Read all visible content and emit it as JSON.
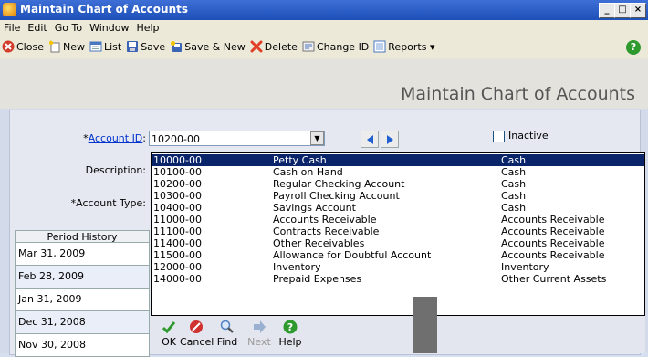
{
  "window": {
    "title": "Maintain Chart of Accounts"
  },
  "menu": [
    "File",
    "Edit",
    "Go To",
    "Window",
    "Help"
  ],
  "toolbar": [
    {
      "label": "Close",
      "icon": "close-icon"
    },
    {
      "label": "New",
      "icon": "new-icon"
    },
    {
      "label": "List",
      "icon": "list-icon"
    },
    {
      "label": "Save",
      "icon": "save-icon"
    },
    {
      "label": "Save & New",
      "icon": "save-new-icon"
    },
    {
      "label": "Delete",
      "icon": "delete-icon"
    },
    {
      "label": "Change ID",
      "icon": "change-id-icon"
    },
    {
      "label": "Reports ▾",
      "icon": "reports-icon"
    }
  ],
  "header": {
    "title": "Maintain Chart of Accounts"
  },
  "form": {
    "account_id_star": "*",
    "account_id_label": "Account ID",
    "account_id_colon": ":",
    "account_id_value": "10200-00",
    "inactive_label": "Inactive",
    "description_label": "Description:",
    "account_type_label": "*Account Type:"
  },
  "period_history": {
    "header": "Period History",
    "rows": [
      "Mar 31, 2009",
      "Feb 28, 2009",
      "Jan 31, 2009",
      "Dec 31, 2008",
      "Nov 30, 2008"
    ]
  },
  "dropdown": {
    "selected_index": 0,
    "rows": [
      {
        "id": "10000-00",
        "name": "Petty Cash",
        "type": "Cash"
      },
      {
        "id": "10100-00",
        "name": "Cash on Hand",
        "type": "Cash"
      },
      {
        "id": "10200-00",
        "name": "Regular Checking Account",
        "type": "Cash"
      },
      {
        "id": "10300-00",
        "name": "Payroll Checking Account",
        "type": "Cash"
      },
      {
        "id": "10400-00",
        "name": "Savings Account",
        "type": "Cash"
      },
      {
        "id": "11000-00",
        "name": "Accounts Receivable",
        "type": "Accounts Receivable"
      },
      {
        "id": "11100-00",
        "name": "Contracts Receivable",
        "type": "Accounts Receivable"
      },
      {
        "id": "11400-00",
        "name": "Other Receivables",
        "type": "Accounts Receivable"
      },
      {
        "id": "11500-00",
        "name": "Allowance for Doubtful Account",
        "type": "Accounts Receivable"
      },
      {
        "id": "12000-00",
        "name": "Inventory",
        "type": "Inventory"
      },
      {
        "id": "14000-00",
        "name": "Prepaid Expenses",
        "type": "Other Current Assets"
      }
    ],
    "tools": [
      {
        "label": "OK",
        "icon": "ok-check-icon",
        "color": "#2e9a2e"
      },
      {
        "label": "Cancel",
        "icon": "cancel-icon",
        "color": "#d03030"
      },
      {
        "label": "Find",
        "icon": "find-magnifier-icon",
        "color": "#5080c0"
      },
      {
        "label": "Next",
        "icon": "next-arrow-icon",
        "color": "#9ab0d0"
      },
      {
        "label": "Help",
        "icon": "help-icon",
        "color": "#2e9a2e"
      }
    ]
  },
  "colors": {
    "titlebar": "#1d4fb8",
    "selection": "#0a246a",
    "panel": "#e5e8f1"
  }
}
